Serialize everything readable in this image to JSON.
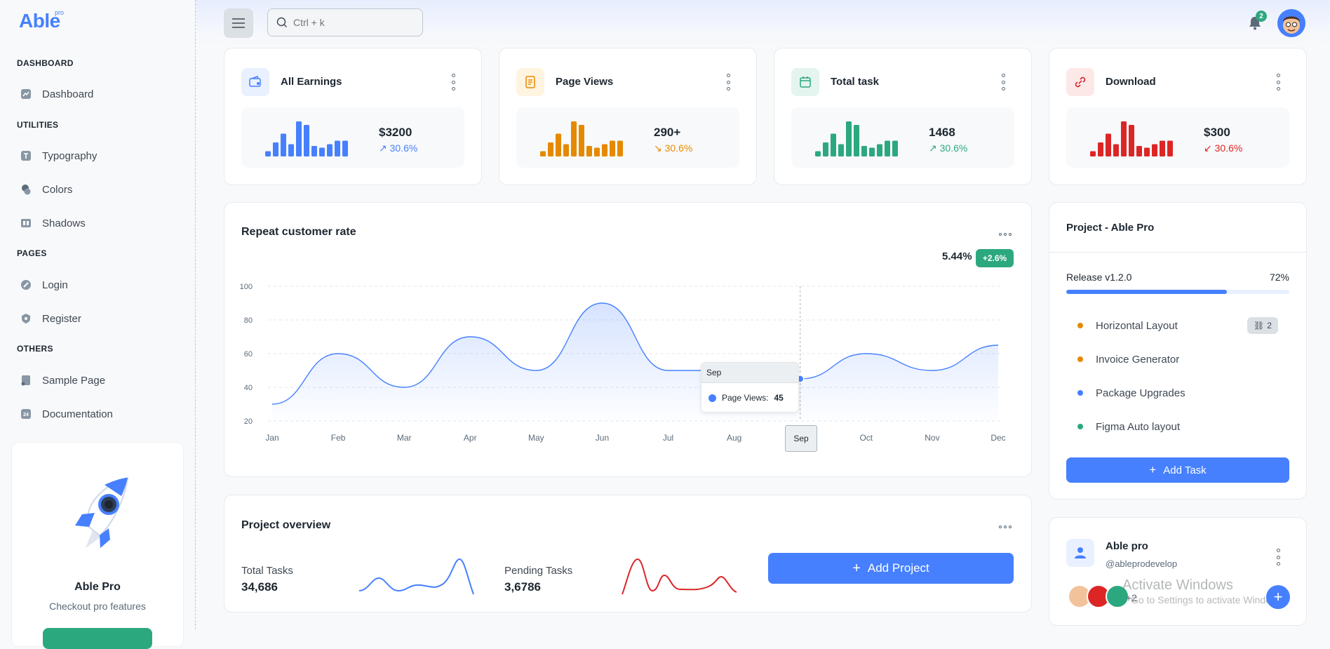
{
  "brand": {
    "name": "Able",
    "tag": "pro"
  },
  "sidebar": {
    "captions": [
      "DASHBOARD",
      "UTILITIES",
      "PAGES",
      "OTHERS"
    ],
    "items": [
      {
        "label": "Dashboard",
        "icon": "chart-icon"
      },
      {
        "label": "Typography",
        "icon": "text-icon"
      },
      {
        "label": "Colors",
        "icon": "palette-icon"
      },
      {
        "label": "Shadows",
        "icon": "shadow-icon"
      },
      {
        "label": "Login",
        "icon": "shield-icon"
      },
      {
        "label": "Register",
        "icon": "security-icon"
      },
      {
        "label": "Sample Page",
        "icon": "page-icon"
      },
      {
        "label": "Documentation",
        "icon": "doc-icon"
      }
    ],
    "promo": {
      "title": "Able Pro",
      "subtitle": "Checkout pro features"
    }
  },
  "header": {
    "search_placeholder": "Ctrl + k",
    "notifications": "2"
  },
  "stats": [
    {
      "title": "All Earnings",
      "value": "$3200",
      "pct": "30.6%",
      "trend": "up",
      "color": "#4680ff",
      "bg": "#e9f0ff",
      "icon": "wallet-icon",
      "bars": [
        0.15,
        0.4,
        0.65,
        0.35,
        1.0,
        0.9,
        0.3,
        0.25,
        0.35,
        0.45,
        0.45
      ]
    },
    {
      "title": "Page Views",
      "value": "290+",
      "pct": "30.6%",
      "trend": "down",
      "color": "#e58a00",
      "bg": "#fff4e0",
      "icon": "document-icon",
      "bars": [
        0.15,
        0.4,
        0.65,
        0.35,
        1.0,
        0.9,
        0.3,
        0.25,
        0.35,
        0.45,
        0.45
      ]
    },
    {
      "title": "Total task",
      "value": "1468",
      "pct": "30.6%",
      "trend": "up",
      "color": "#2ca87f",
      "bg": "#e3f5ee",
      "icon": "calendar-icon",
      "bars": [
        0.15,
        0.4,
        0.65,
        0.35,
        1.0,
        0.9,
        0.3,
        0.25,
        0.35,
        0.45,
        0.45
      ]
    },
    {
      "title": "Download",
      "value": "$300",
      "pct": "30.6%",
      "trend": "down",
      "color": "#dc2626",
      "bg": "#fde8e8",
      "icon": "link-icon",
      "bars": [
        0.15,
        0.4,
        0.65,
        0.35,
        1.0,
        0.9,
        0.3,
        0.25,
        0.35,
        0.45,
        0.45
      ]
    }
  ],
  "repeat_rate": {
    "title": "Repeat customer rate",
    "value": "5.44%",
    "badge": "+2.6%",
    "tooltip": {
      "month": "Sep",
      "series": "Page Views:",
      "value": "45"
    }
  },
  "chart_data": {
    "type": "area",
    "categories": [
      "Jan",
      "Feb",
      "Mar",
      "Apr",
      "May",
      "Jun",
      "Jul",
      "Aug",
      "Sep",
      "Oct",
      "Nov",
      "Dec"
    ],
    "series": [
      {
        "name": "Page Views",
        "values": [
          30,
          60,
          40,
          70,
          50,
          90,
          50,
          50,
          45,
          60,
          50,
          65
        ]
      }
    ],
    "yticks": [
      100,
      80,
      60,
      40,
      20
    ],
    "ylim": [
      20,
      100
    ],
    "grid": true,
    "color": "#4680ff"
  },
  "overview": {
    "title": "Project overview",
    "total_label": "Total Tasks",
    "total_value": "34,686",
    "pending_label": "Pending Tasks",
    "pending_value": "3,6786",
    "add_button": "Add Project"
  },
  "project": {
    "title": "Project - Able Pro",
    "release": "Release v1.2.0",
    "progress_pct": "72%",
    "progress_value": 72,
    "tasks": [
      {
        "label": "Horizontal Layout",
        "color": "#e58a00"
      },
      {
        "label": "Invoice Generator",
        "color": "#e58a00"
      },
      {
        "label": "Package Upgrades",
        "color": "#4680ff"
      },
      {
        "label": "Figma Auto layout",
        "color": "#2ca87f"
      }
    ],
    "link_count": "2",
    "add_button": "Add Task"
  },
  "user_card": {
    "name": "Able pro",
    "handle": "@ableprodevelop",
    "more": "+2"
  },
  "watermark": {
    "line1": "Activate Windows",
    "line2": "Go to Settings to activate Windows."
  }
}
